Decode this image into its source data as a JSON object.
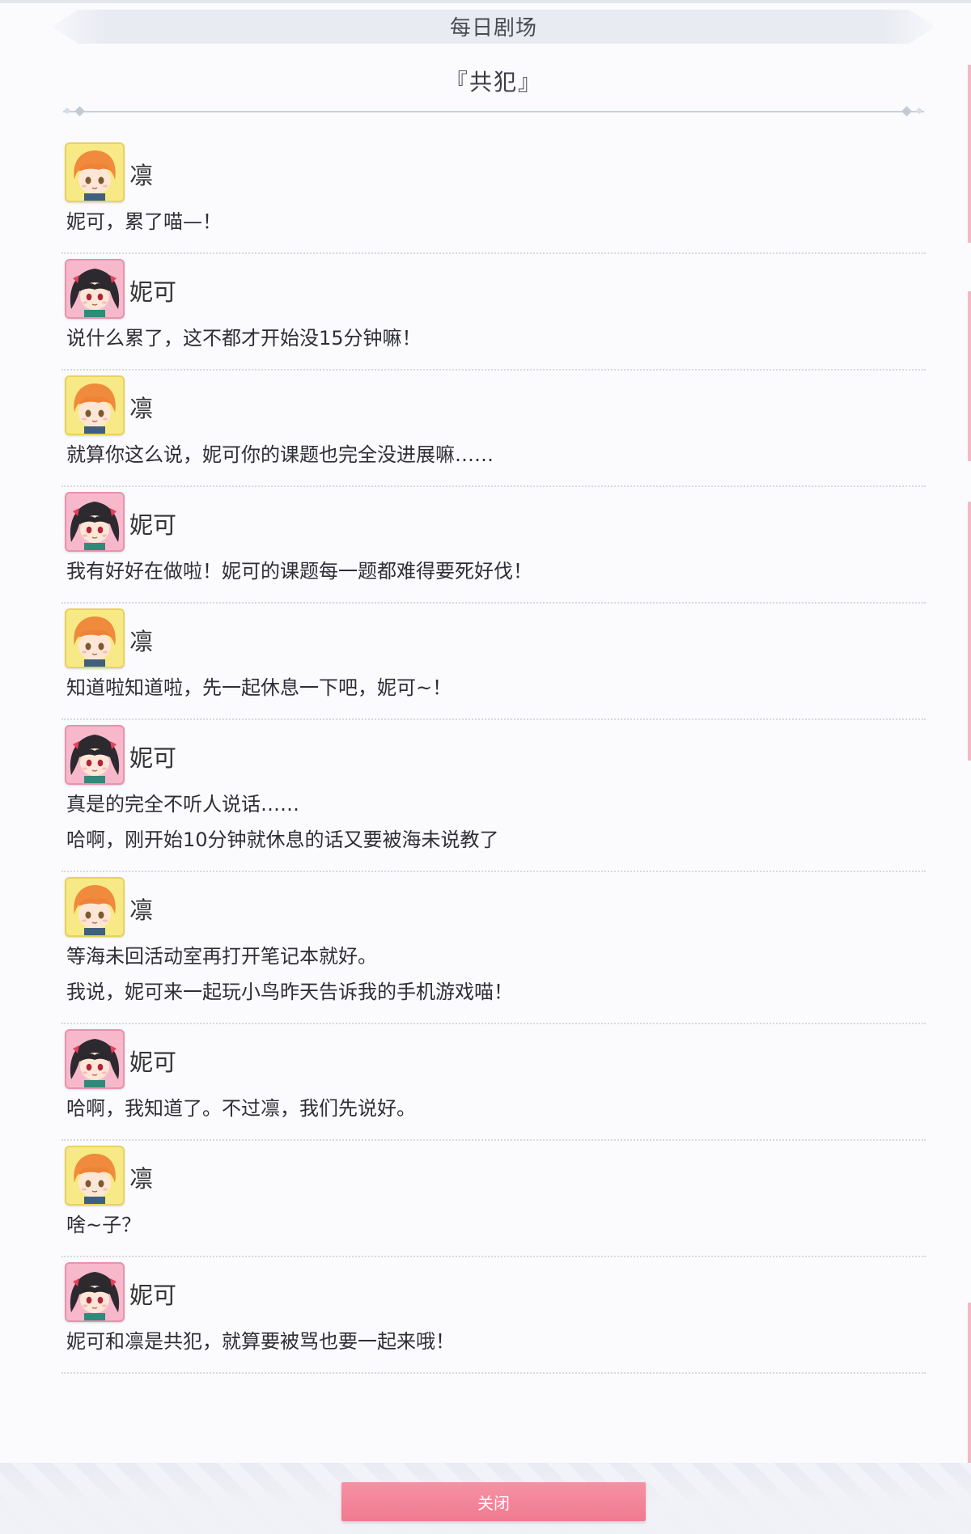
{
  "header": {
    "banner_title": "每日剧场",
    "episode_title": "『共犯』"
  },
  "dialogue": [
    {
      "speaker": "凛",
      "character": "rin",
      "lines": [
        "妮可，累了喵—！"
      ]
    },
    {
      "speaker": "妮可",
      "character": "nico",
      "lines": [
        "说什么累了，这不都才开始没15分钟嘛！"
      ]
    },
    {
      "speaker": "凛",
      "character": "rin",
      "lines": [
        "就算你这么说，妮可你的课题也完全没进展嘛……"
      ]
    },
    {
      "speaker": "妮可",
      "character": "nico",
      "lines": [
        "我有好好在做啦！妮可的课题每一题都难得要死好伐！"
      ]
    },
    {
      "speaker": "凛",
      "character": "rin",
      "lines": [
        "知道啦知道啦，先一起休息一下吧，妮可~！"
      ]
    },
    {
      "speaker": "妮可",
      "character": "nico",
      "lines": [
        "真是的完全不听人说话……",
        "哈啊，刚开始10分钟就休息的话又要被海未说教了"
      ]
    },
    {
      "speaker": "凛",
      "character": "rin",
      "lines": [
        "等海未回活动室再打开笔记本就好。",
        "我说，妮可来一起玩小鸟昨天告诉我的手机游戏喵！"
      ]
    },
    {
      "speaker": "妮可",
      "character": "nico",
      "lines": [
        "哈啊，我知道了。不过凛，我们先说好。"
      ]
    },
    {
      "speaker": "凛",
      "character": "rin",
      "lines": [
        "啥~子？"
      ]
    },
    {
      "speaker": "妮可",
      "character": "nico",
      "lines": [
        "妮可和凛是共犯，就算要被骂也要一起来哦！"
      ]
    }
  ],
  "footer": {
    "close_label": "关闭"
  },
  "colors": {
    "accent": "#ef7a90",
    "rin_avatar_bg": "#f7ea86",
    "nico_avatar_bg": "#f7b8cc"
  }
}
